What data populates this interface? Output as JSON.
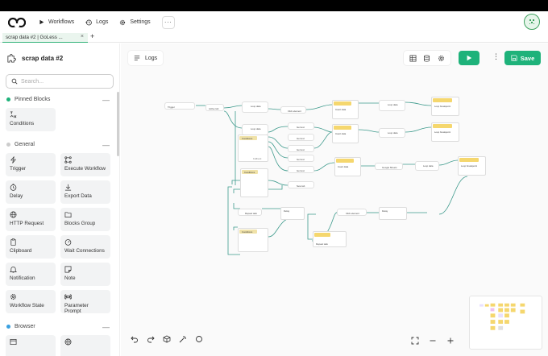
{
  "nav": {
    "items": [
      {
        "label": "Workflows",
        "icon": "play-icon"
      },
      {
        "label": "Logs",
        "icon": "history-icon"
      },
      {
        "label": "Settings",
        "icon": "gear-icon"
      }
    ],
    "more": "···"
  },
  "tab": {
    "title": "scrap data #2 | GoLess ...",
    "close": "×",
    "add": "+"
  },
  "sidebar": {
    "workflow_name": "scrap data #2",
    "search_placeholder": "Search...",
    "sections": {
      "pinned": "Pinned Blocks",
      "general": "General",
      "browser": "Browser"
    },
    "pinned_blocks": [
      "Conditions"
    ],
    "general_blocks": [
      "Trigger",
      "Execute Workflow",
      "Delay",
      "Export Data",
      "HTTP Request",
      "Blocks Group",
      "Clipboard",
      "Wait Connections",
      "Notification",
      "Note",
      "Workflow State",
      "Parameter Prompt"
    ],
    "collapse": "—"
  },
  "canvas": {
    "logs_label": "Logs",
    "save_label": "Save",
    "nodes": {
      "trigger": "Trigger",
      "active_tab": "Active tab",
      "loop_data": "Loop data",
      "click": "Click element",
      "conditions": "Conditions",
      "google_sheets": "Google Sheets",
      "delay": "Delay",
      "loop_breakpoint": "Loop breakpoint",
      "repeat_task": "Repeat task",
      "new_tab": "New tab",
      "get_text": "Get text",
      "insert_data": "Insert data",
      "fallback": "Fallback"
    }
  },
  "colors": {
    "accent": "#1eb27a",
    "pinned_dot": "#1eb27a",
    "general_dot": "#cccccc",
    "browser_dot": "#3aa0e0",
    "edge": "#3d9a8c",
    "note": "#f5d76e"
  }
}
